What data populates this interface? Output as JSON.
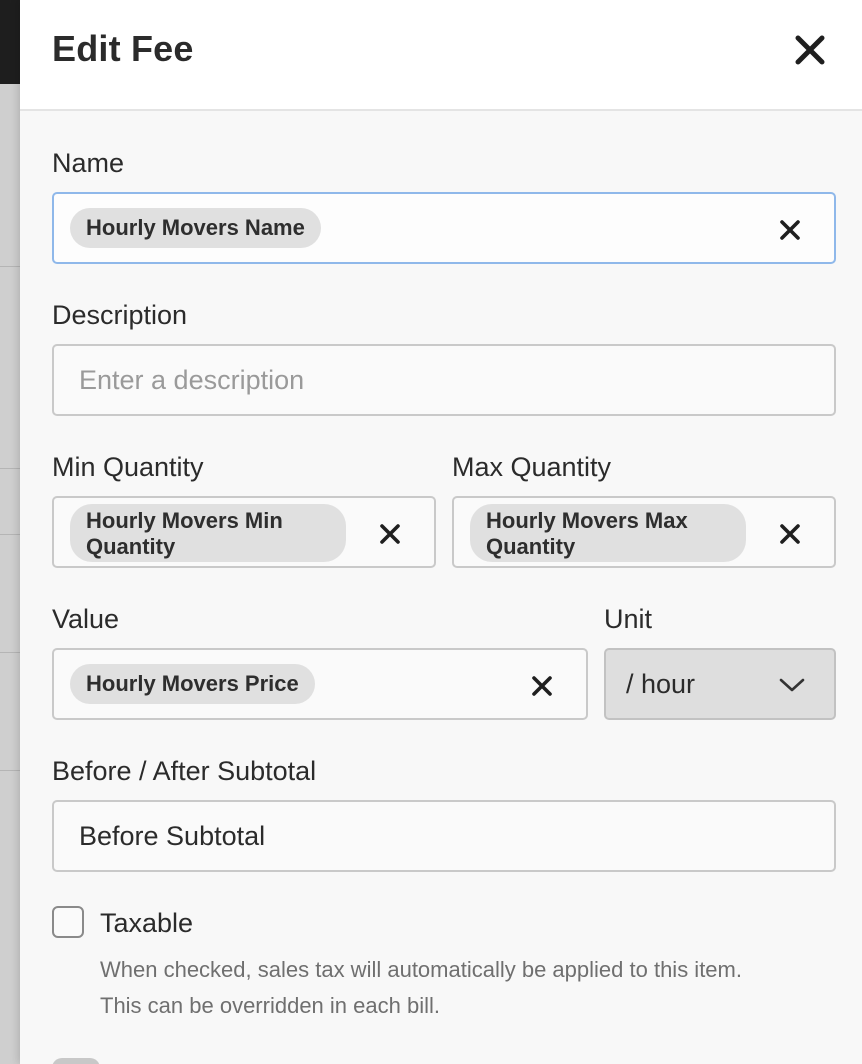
{
  "header": {
    "title": "Edit Fee",
    "close_icon": "close-icon"
  },
  "fields": {
    "name": {
      "label": "Name",
      "chip": "Hourly Movers Name"
    },
    "description": {
      "label": "Description",
      "placeholder": "Enter a description"
    },
    "min_quantity": {
      "label": "Min Quantity",
      "chip_line1": "Hourly Movers Min",
      "chip_line2": "Quantity"
    },
    "max_quantity": {
      "label": "Max Quantity",
      "chip_line1": "Hourly Movers Max",
      "chip_line2": "Quantity"
    },
    "value": {
      "label": "Value",
      "chip": "Hourly Movers Price"
    },
    "unit": {
      "label": "Unit",
      "selected": "/ hour"
    },
    "subtotal": {
      "label": "Before / After Subtotal",
      "value": "Before Subtotal"
    },
    "taxable": {
      "label": "Taxable",
      "checked": false,
      "help_line1": "When checked, sales tax will automatically be applied to this item.",
      "help_line2": "This can be overridden in each bill."
    }
  },
  "colors": {
    "focus_border": "#8fb8ea",
    "chip_bg": "#e0e0e0",
    "select_bg": "#dedede"
  }
}
